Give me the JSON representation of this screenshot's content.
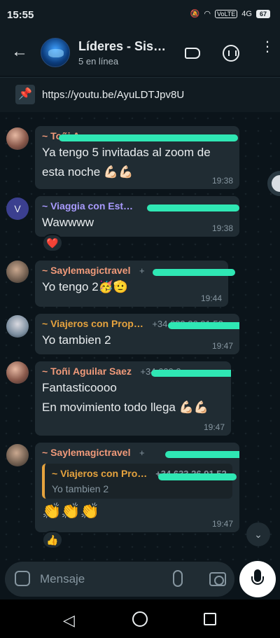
{
  "status": {
    "time": "15:55",
    "volte": "VoLTE",
    "network": "4G",
    "battery": "67"
  },
  "header": {
    "title": "Líderes - Siste…",
    "subtitle": "5 en línea"
  },
  "pinned": {
    "link": "https://youtu.be/AyuLDTJpv8U"
  },
  "messages": [
    {
      "sender": "~ Toñi A",
      "sender_color": "#f09a7a",
      "text": "Ya tengo 5 invitadas al zoom de\nesta noche 💪🏻💪🏻",
      "time": "19:38"
    },
    {
      "sender": "~ Viaggia con Est…",
      "sender_color": "#a99bff",
      "text": "Wawwww",
      "time": "19:38",
      "reaction": "❤️"
    },
    {
      "sender": "~ Saylemagictravel",
      "sender_color": "#f09a7a",
      "phone": "+",
      "text": "Yo tengo 2🥳🫡",
      "time": "19:44"
    },
    {
      "sender": "~ Viajeros con Prop…",
      "sender_color": "#e6a33e",
      "phone": "+34 633 26 91 52",
      "text": "Yo tambien 2",
      "time": "19:47"
    },
    {
      "sender": "~ Toñi Aguilar Saez",
      "sender_color": "#f09a7a",
      "phone": "+34 600 0",
      "text": "Fantasticoooo\nEn movimiento todo llega 💪🏻💪🏻",
      "time": "19:47"
    },
    {
      "sender": "~ Saylemagictravel",
      "sender_color": "#f09a7a",
      "phone": "+",
      "quote_sender": "~ Viajeros con Pro…",
      "quote_phone": "+34 633 26 91 52",
      "quote_text": "Yo tambien 2",
      "text": "👏👏👏",
      "time": "19:47",
      "reaction": "👍"
    }
  ],
  "input": {
    "placeholder": "Mensaje"
  },
  "icons": [
    "back-arrow-icon",
    "label-icon",
    "group-call-icon",
    "more-vert-icon",
    "pin-icon",
    "scroll-down-icon",
    "sticker-icon",
    "attach-icon",
    "camera-icon",
    "mic-icon",
    "nav-back-icon",
    "nav-home-icon",
    "nav-recents-icon"
  ]
}
